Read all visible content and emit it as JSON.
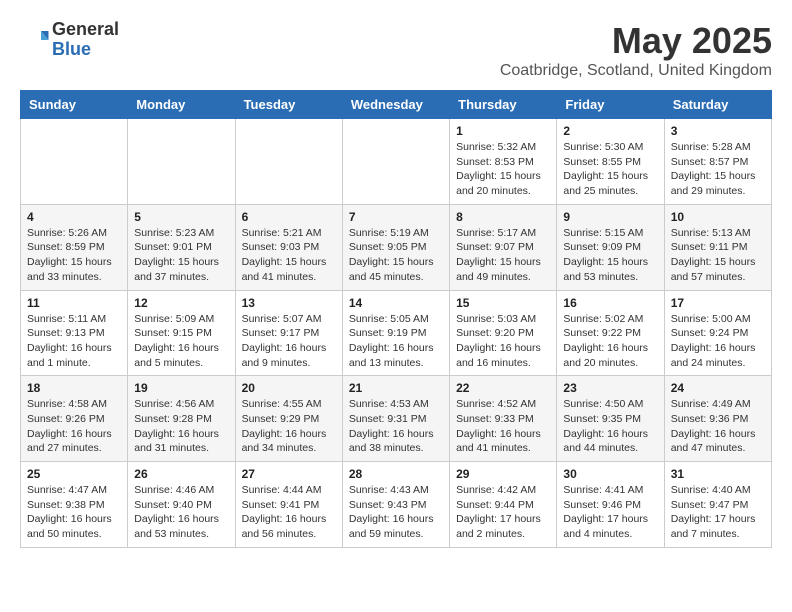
{
  "header": {
    "logo_general": "General",
    "logo_blue": "Blue",
    "month_title": "May 2025",
    "location": "Coatbridge, Scotland, United Kingdom"
  },
  "days_of_week": [
    "Sunday",
    "Monday",
    "Tuesday",
    "Wednesday",
    "Thursday",
    "Friday",
    "Saturday"
  ],
  "weeks": [
    [
      {
        "day": "",
        "info": ""
      },
      {
        "day": "",
        "info": ""
      },
      {
        "day": "",
        "info": ""
      },
      {
        "day": "",
        "info": ""
      },
      {
        "day": "1",
        "info": "Sunrise: 5:32 AM\nSunset: 8:53 PM\nDaylight: 15 hours\nand 20 minutes."
      },
      {
        "day": "2",
        "info": "Sunrise: 5:30 AM\nSunset: 8:55 PM\nDaylight: 15 hours\nand 25 minutes."
      },
      {
        "day": "3",
        "info": "Sunrise: 5:28 AM\nSunset: 8:57 PM\nDaylight: 15 hours\nand 29 minutes."
      }
    ],
    [
      {
        "day": "4",
        "info": "Sunrise: 5:26 AM\nSunset: 8:59 PM\nDaylight: 15 hours\nand 33 minutes."
      },
      {
        "day": "5",
        "info": "Sunrise: 5:23 AM\nSunset: 9:01 PM\nDaylight: 15 hours\nand 37 minutes."
      },
      {
        "day": "6",
        "info": "Sunrise: 5:21 AM\nSunset: 9:03 PM\nDaylight: 15 hours\nand 41 minutes."
      },
      {
        "day": "7",
        "info": "Sunrise: 5:19 AM\nSunset: 9:05 PM\nDaylight: 15 hours\nand 45 minutes."
      },
      {
        "day": "8",
        "info": "Sunrise: 5:17 AM\nSunset: 9:07 PM\nDaylight: 15 hours\nand 49 minutes."
      },
      {
        "day": "9",
        "info": "Sunrise: 5:15 AM\nSunset: 9:09 PM\nDaylight: 15 hours\nand 53 minutes."
      },
      {
        "day": "10",
        "info": "Sunrise: 5:13 AM\nSunset: 9:11 PM\nDaylight: 15 hours\nand 57 minutes."
      }
    ],
    [
      {
        "day": "11",
        "info": "Sunrise: 5:11 AM\nSunset: 9:13 PM\nDaylight: 16 hours\nand 1 minute."
      },
      {
        "day": "12",
        "info": "Sunrise: 5:09 AM\nSunset: 9:15 PM\nDaylight: 16 hours\nand 5 minutes."
      },
      {
        "day": "13",
        "info": "Sunrise: 5:07 AM\nSunset: 9:17 PM\nDaylight: 16 hours\nand 9 minutes."
      },
      {
        "day": "14",
        "info": "Sunrise: 5:05 AM\nSunset: 9:19 PM\nDaylight: 16 hours\nand 13 minutes."
      },
      {
        "day": "15",
        "info": "Sunrise: 5:03 AM\nSunset: 9:20 PM\nDaylight: 16 hours\nand 16 minutes."
      },
      {
        "day": "16",
        "info": "Sunrise: 5:02 AM\nSunset: 9:22 PM\nDaylight: 16 hours\nand 20 minutes."
      },
      {
        "day": "17",
        "info": "Sunrise: 5:00 AM\nSunset: 9:24 PM\nDaylight: 16 hours\nand 24 minutes."
      }
    ],
    [
      {
        "day": "18",
        "info": "Sunrise: 4:58 AM\nSunset: 9:26 PM\nDaylight: 16 hours\nand 27 minutes."
      },
      {
        "day": "19",
        "info": "Sunrise: 4:56 AM\nSunset: 9:28 PM\nDaylight: 16 hours\nand 31 minutes."
      },
      {
        "day": "20",
        "info": "Sunrise: 4:55 AM\nSunset: 9:29 PM\nDaylight: 16 hours\nand 34 minutes."
      },
      {
        "day": "21",
        "info": "Sunrise: 4:53 AM\nSunset: 9:31 PM\nDaylight: 16 hours\nand 38 minutes."
      },
      {
        "day": "22",
        "info": "Sunrise: 4:52 AM\nSunset: 9:33 PM\nDaylight: 16 hours\nand 41 minutes."
      },
      {
        "day": "23",
        "info": "Sunrise: 4:50 AM\nSunset: 9:35 PM\nDaylight: 16 hours\nand 44 minutes."
      },
      {
        "day": "24",
        "info": "Sunrise: 4:49 AM\nSunset: 9:36 PM\nDaylight: 16 hours\nand 47 minutes."
      }
    ],
    [
      {
        "day": "25",
        "info": "Sunrise: 4:47 AM\nSunset: 9:38 PM\nDaylight: 16 hours\nand 50 minutes."
      },
      {
        "day": "26",
        "info": "Sunrise: 4:46 AM\nSunset: 9:40 PM\nDaylight: 16 hours\nand 53 minutes."
      },
      {
        "day": "27",
        "info": "Sunrise: 4:44 AM\nSunset: 9:41 PM\nDaylight: 16 hours\nand 56 minutes."
      },
      {
        "day": "28",
        "info": "Sunrise: 4:43 AM\nSunset: 9:43 PM\nDaylight: 16 hours\nand 59 minutes."
      },
      {
        "day": "29",
        "info": "Sunrise: 4:42 AM\nSunset: 9:44 PM\nDaylight: 17 hours\nand 2 minutes."
      },
      {
        "day": "30",
        "info": "Sunrise: 4:41 AM\nSunset: 9:46 PM\nDaylight: 17 hours\nand 4 minutes."
      },
      {
        "day": "31",
        "info": "Sunrise: 4:40 AM\nSunset: 9:47 PM\nDaylight: 17 hours\nand 7 minutes."
      }
    ]
  ]
}
